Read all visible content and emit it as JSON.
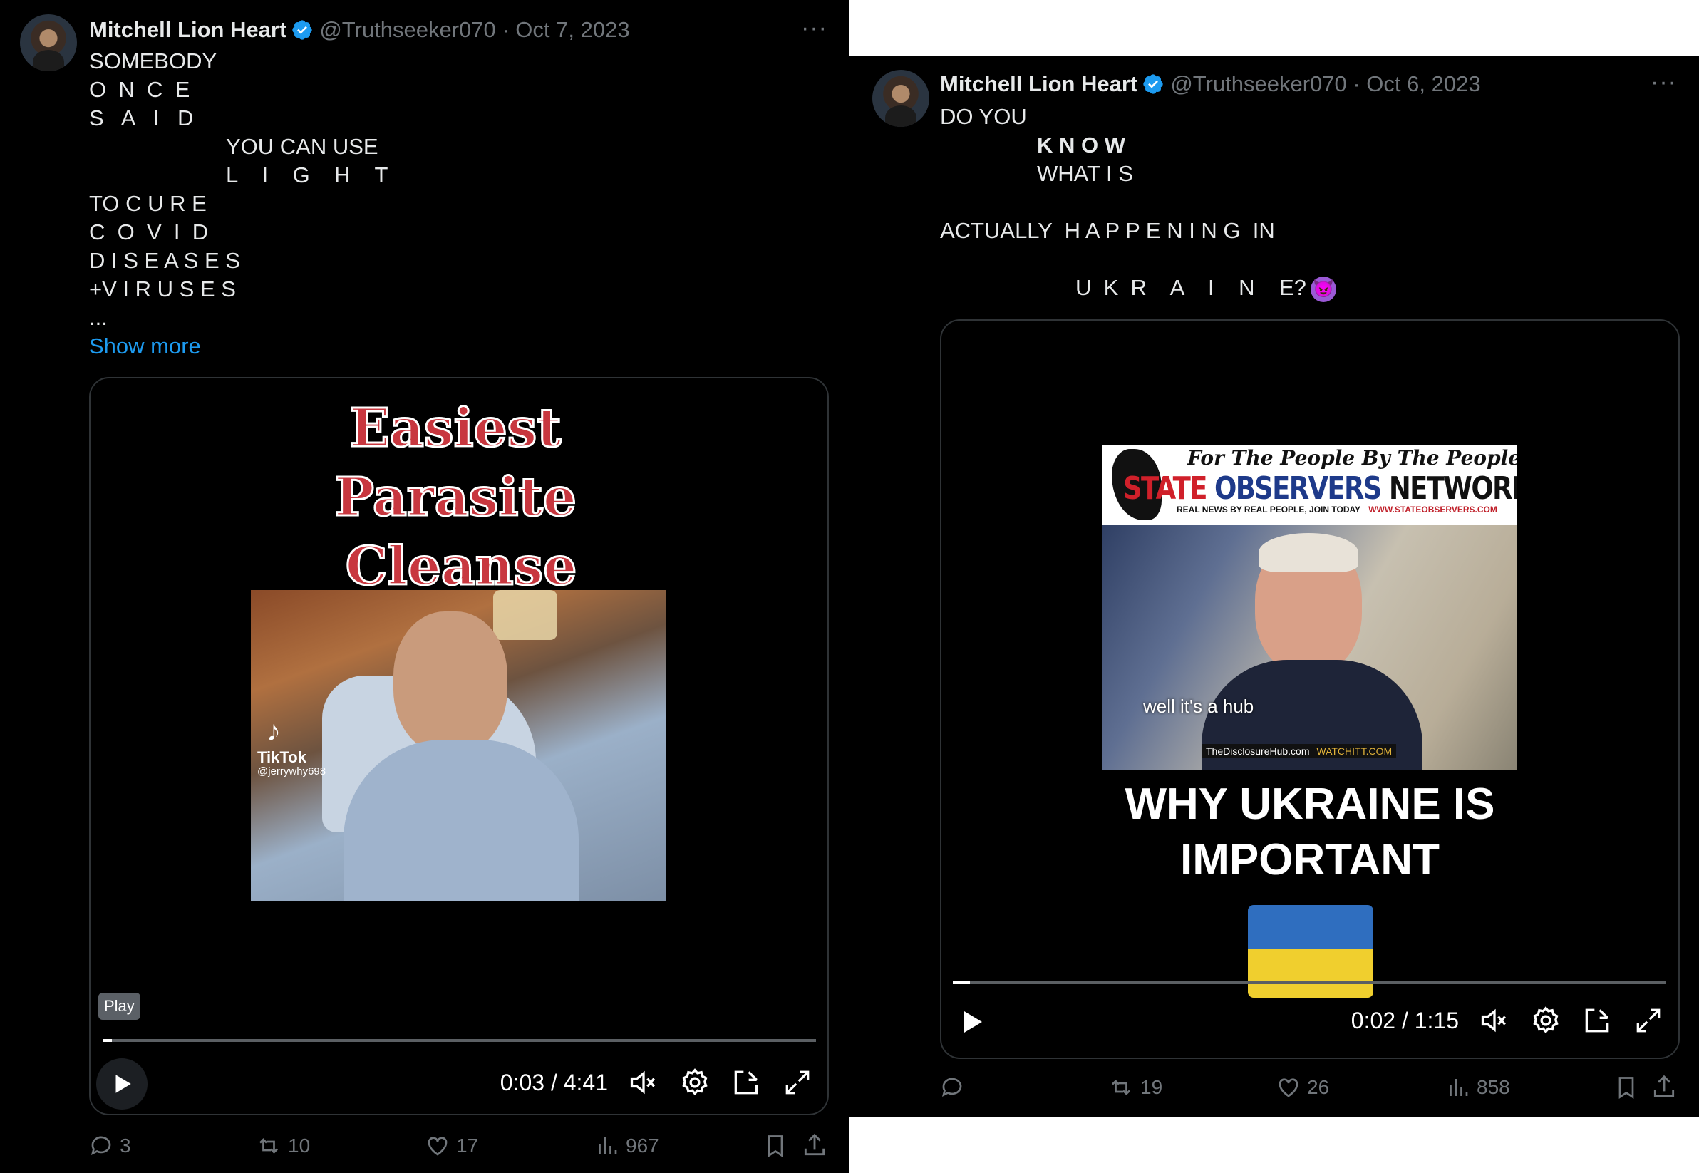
{
  "left_tweet": {
    "author_name": "Mitchell Lion Heart",
    "meta": "@Truthseeker070 · Oct 7, 2023",
    "more": "···",
    "text_lines": [
      {
        "text": "SOMEBODY",
        "indent": 0
      },
      {
        "text": "O  N  C  E",
        "indent": 0
      },
      {
        "text": "S   A   I   D",
        "indent": 0
      },
      {
        "text": "YOU CAN USE",
        "indent": 1
      },
      {
        "text": "L    I    G    H    T",
        "indent": 1
      },
      {
        "text": "TO C U R E",
        "indent": 0
      },
      {
        "text": "C  O  V  I  D",
        "indent": 0
      },
      {
        "text": "D I S E A S E S",
        "indent": 0
      },
      {
        "text": "+V I R U S E S",
        "indent": 0
      },
      {
        "text": "...",
        "indent": 0
      }
    ],
    "show_more": "Show more",
    "video": {
      "title_lines": [
        "Easiest",
        "Parasite",
        "Cleanse"
      ],
      "watermark_brand": "TikTok",
      "watermark_user": "@jerrywhy698",
      "tooltip": "Play",
      "time": "0:03 / 4:41",
      "progress": 0.012
    },
    "stats": {
      "replies": "3",
      "reposts": "10",
      "likes": "17",
      "views": "967"
    }
  },
  "right_tweet": {
    "author_name": "Mitchell Lion Heart",
    "meta": "@Truthseeker070 · Oct 6, 2023",
    "more": "···",
    "text_lines": [
      {
        "text": "DO YOU",
        "indent": 0
      },
      {
        "text": "K N O W",
        "indent": 1,
        "bold": true
      },
      {
        "text": "WHAT I S",
        "indent": 1
      },
      {
        "text": "",
        "indent": 0
      },
      {
        "text": "ACTUALLY  H A P P E N I N G  IN",
        "indent": 0
      },
      {
        "text": "",
        "indent": 0
      },
      {
        "text": "U  K  R    A    I    N    E?",
        "indent": 2
      }
    ],
    "emoji": "😈",
    "video": {
      "banner_top": "For The People By The People",
      "banner_main_red": "STATE",
      "banner_main_blue": "OBSERVERS",
      "banner_main_black": "NETWORK",
      "banner_sub_left": "REAL NEWS BY REAL PEOPLE, JOIN TODAY",
      "banner_sub_right": "WWW.STATEOBSERVERS.COM",
      "subtitle": "well it's a hub",
      "source_tag": "TheDisclosureHub.com",
      "source_tag2": "WATCHITT.COM",
      "headline_lines": [
        "WHY UKRAINE IS",
        "IMPORTANT"
      ],
      "time": "0:02 / 1:15",
      "progress": 0.024
    },
    "stats": {
      "replies": "",
      "reposts": "19",
      "likes": "26",
      "views": "858"
    }
  },
  "colors": {
    "text": "#e7e9ea",
    "muted": "#71767b",
    "link": "#1d9bf0",
    "verified": "#1d9bf0",
    "card_border": "#2f3336"
  }
}
